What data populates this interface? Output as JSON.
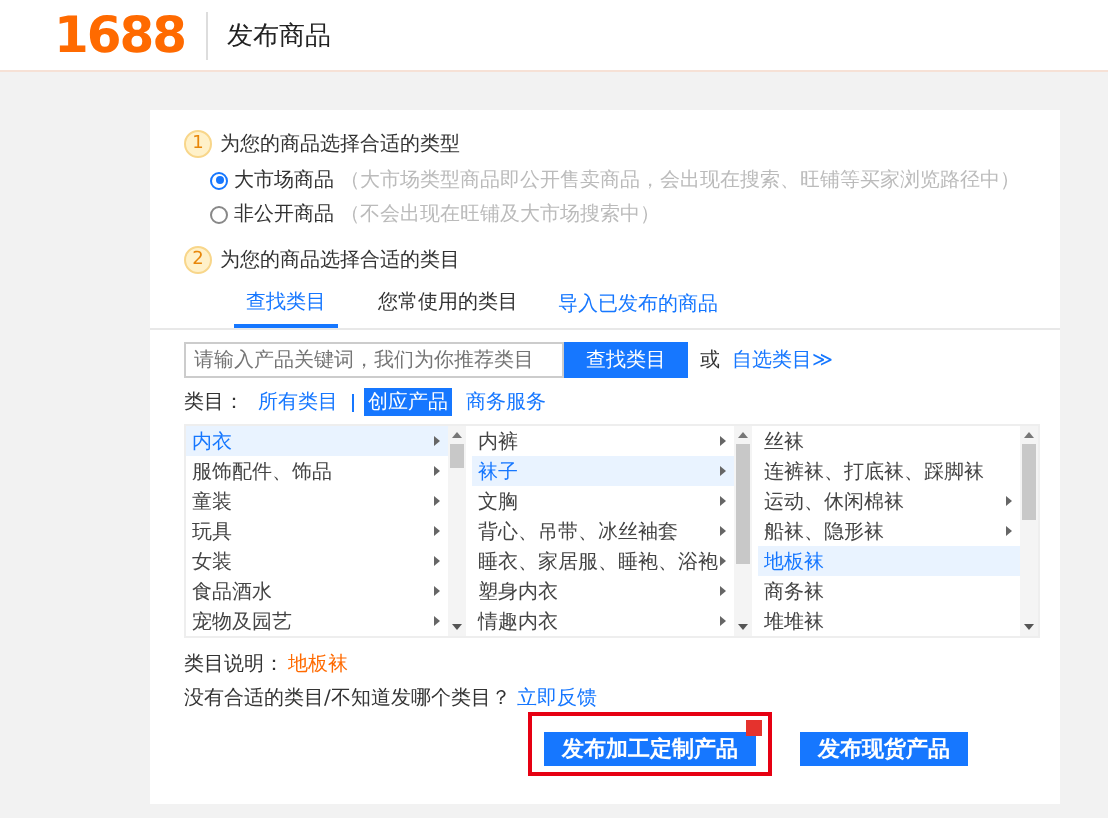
{
  "header": {
    "logo": "1688",
    "title": "发布商品"
  },
  "step1": {
    "number": "1",
    "title": "为您的商品选择合适的类型",
    "options": [
      {
        "label": "大市场商品",
        "hint": "（大市场类型商品即公开售卖商品，会出现在搜索、旺铺等买家浏览路径中）",
        "selected": true
      },
      {
        "label": "非公开商品",
        "hint": "（不会出现在旺铺及大市场搜索中）",
        "selected": false
      }
    ]
  },
  "step2": {
    "number": "2",
    "title": "为您的商品选择合适的类目",
    "tabs": [
      {
        "label": "查找类目",
        "kind": "tab",
        "selected": true
      },
      {
        "label": "您常使用的类目",
        "kind": "tab",
        "selected": false
      },
      {
        "label": "导入已发布的商品",
        "kind": "link",
        "selected": false
      }
    ],
    "search": {
      "placeholder": "请输入产品关键词，我们为你推荐类目",
      "button": "查找类目",
      "or": "或",
      "custom": "自选类目≫"
    },
    "filter": {
      "label": "类目：",
      "items": [
        {
          "label": "所有类目",
          "selected": false
        },
        {
          "label": "创应产品",
          "selected": true
        },
        {
          "label": "商务服务",
          "selected": false
        }
      ]
    },
    "columns": [
      [
        {
          "label": "内衣",
          "has_children": true,
          "selected": true
        },
        {
          "label": "服饰配件、饰品",
          "has_children": true,
          "selected": false
        },
        {
          "label": "童装",
          "has_children": true,
          "selected": false
        },
        {
          "label": "玩具",
          "has_children": true,
          "selected": false
        },
        {
          "label": "女装",
          "has_children": true,
          "selected": false
        },
        {
          "label": "食品酒水",
          "has_children": true,
          "selected": false
        },
        {
          "label": "宠物及园艺",
          "has_children": true,
          "selected": false
        }
      ],
      [
        {
          "label": "内裤",
          "has_children": true,
          "selected": false
        },
        {
          "label": "袜子",
          "has_children": true,
          "selected": true
        },
        {
          "label": "文胸",
          "has_children": true,
          "selected": false
        },
        {
          "label": "背心、吊带、冰丝袖套",
          "has_children": true,
          "selected": false
        },
        {
          "label": "睡衣、家居服、睡袍、浴袍",
          "has_children": true,
          "selected": false
        },
        {
          "label": "塑身内衣",
          "has_children": true,
          "selected": false
        },
        {
          "label": "情趣内衣",
          "has_children": true,
          "selected": false
        }
      ],
      [
        {
          "label": "丝袜",
          "has_children": false,
          "selected": false
        },
        {
          "label": "连裤袜、打底袜、踩脚袜",
          "has_children": false,
          "selected": false
        },
        {
          "label": "运动、休闲棉袜",
          "has_children": true,
          "selected": false
        },
        {
          "label": "船袜、隐形袜",
          "has_children": true,
          "selected": false
        },
        {
          "label": "地板袜",
          "has_children": false,
          "selected": true
        },
        {
          "label": "商务袜",
          "has_children": false,
          "selected": false
        },
        {
          "label": "堆堆袜",
          "has_children": false,
          "selected": false
        }
      ]
    ],
    "description": {
      "label": "类目说明：",
      "value": "地板袜"
    },
    "feedback": {
      "text": "没有合适的类目/不知道发哪个类目？",
      "link": "立即反馈"
    }
  },
  "buttons": [
    {
      "label": "发布加工定制产品",
      "badge": true,
      "highlighted": true
    },
    {
      "label": "发布现货产品",
      "badge": false,
      "highlighted": false
    }
  ]
}
